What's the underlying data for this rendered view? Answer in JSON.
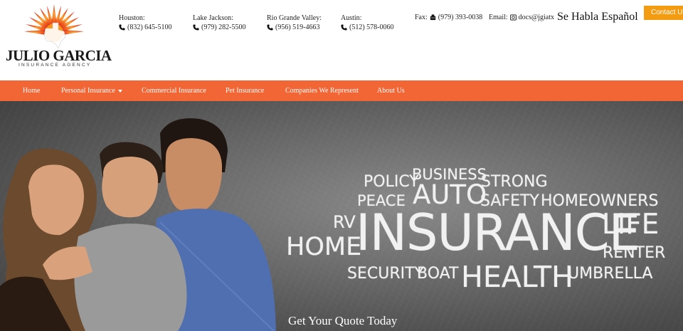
{
  "logo": {
    "name": "Julio Garcia",
    "subtitle": "INSURANCE AGENCY"
  },
  "offices": [
    {
      "city": "Houston:",
      "phone": "(832) 645-5100"
    },
    {
      "city": "Lake Jackson:",
      "phone": "(979) 282-5500"
    },
    {
      "city": "Rio Grande Valley:",
      "phone": "(956) 519-4663"
    },
    {
      "city": "Austin:",
      "phone": "(512) 578-0060"
    }
  ],
  "fax": {
    "label": "Fax:",
    "value": "(979) 393-0038"
  },
  "email": {
    "label": "Email:",
    "value": "docs@jgiatx"
  },
  "language_note": "Se Habla Español",
  "contact_button": "Contact Us!",
  "nav": {
    "home": "Home",
    "personal": "Personal Insurance",
    "commercial": "Commercial Insurance",
    "pet": "Pet Insurance",
    "companies": "Companies We Represent",
    "about": "About Us"
  },
  "hero": {
    "words": {
      "policy": "POLICY",
      "business": "BUSINESS",
      "strong": "STRONG",
      "peace": "PEACE",
      "auto": "AUTO",
      "safety": "SAFETY",
      "homeowners": "HOMEOWNERS",
      "rv": "RV",
      "home": "HOME",
      "insurance": "INSURANCE",
      "life": "LIFE",
      "renter": "RENTER",
      "security": "SECURITY",
      "boat": "BOAT",
      "health": "HEALTH",
      "umbrella": "UMBRELLA"
    },
    "cta": "Get Your Quote Today"
  },
  "colors": {
    "nav_bg": "#f26535",
    "contact_bg": "#f39c12"
  }
}
